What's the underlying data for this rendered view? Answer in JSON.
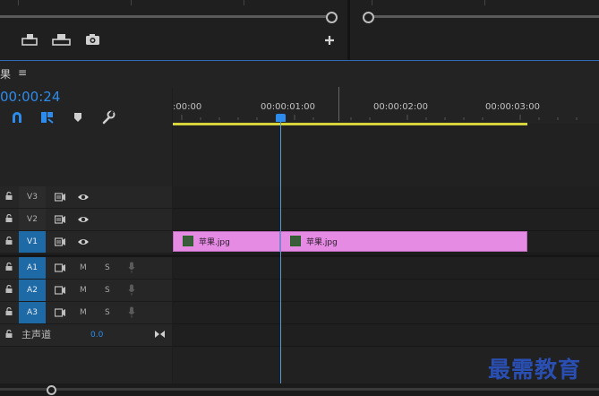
{
  "panel": {
    "title": "果",
    "menu_glyph": "≡"
  },
  "timecode": "00:00:24",
  "ruler": {
    "labels": [
      ":00:00",
      "00:00:01:00",
      "00:00:02:00",
      "00:00:03:00"
    ]
  },
  "tracks": {
    "video": [
      {
        "name": "V3",
        "targeted": false
      },
      {
        "name": "V2",
        "targeted": false
      },
      {
        "name": "V1",
        "targeted": true
      }
    ],
    "audio": [
      {
        "name": "A1",
        "m": "M",
        "s": "S"
      },
      {
        "name": "A2",
        "m": "M",
        "s": "S"
      },
      {
        "name": "A3",
        "m": "M",
        "s": "S"
      }
    ],
    "master": {
      "name": "主声道",
      "value": "0.0"
    }
  },
  "clips": [
    {
      "label": "苹果.jpg"
    },
    {
      "label": "苹果.jpg"
    }
  ],
  "watermark": "最需教育",
  "colors": {
    "accent": "#2d8ceb",
    "clip": "#e58be3",
    "work_area": "#d7d33a",
    "target": "#1e6aa6"
  },
  "icons": {
    "top_toolbar": [
      "insert-icon",
      "overwrite-icon",
      "camera-icon",
      "add-icon"
    ],
    "timeline_tools": [
      "magnet-icon",
      "linked-selection-icon",
      "marker-icon",
      "wrench-icon"
    ]
  }
}
